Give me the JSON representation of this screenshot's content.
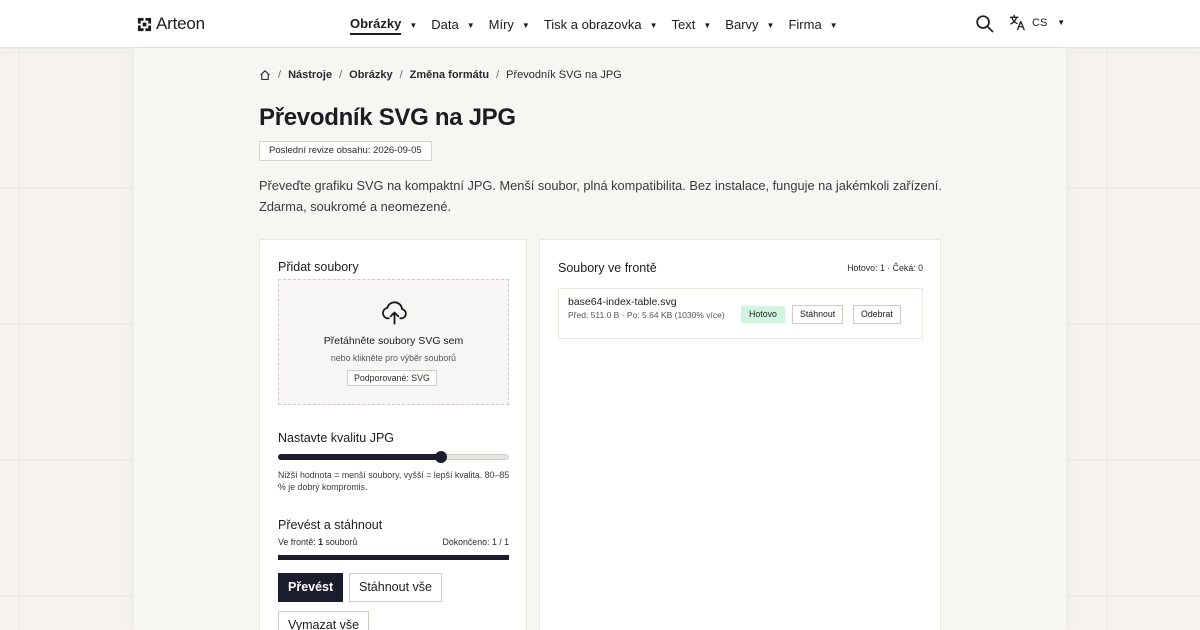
{
  "header": {
    "brand": "Arteon",
    "nav": [
      {
        "label": "Obrázky",
        "active": true
      },
      {
        "label": "Data"
      },
      {
        "label": "Míry"
      },
      {
        "label": "Tisk a obrazovka"
      },
      {
        "label": "Text"
      },
      {
        "label": "Barvy"
      },
      {
        "label": "Firma"
      }
    ],
    "language": "CS"
  },
  "breadcrumb": {
    "items": [
      "Nástroje",
      "Obrázky",
      "Změna formátu"
    ],
    "current": "Převodník SVG na JPG"
  },
  "page": {
    "title": "Převodník SVG na JPG",
    "revision": "Poslední revize obsahu: 2026-09-05",
    "intro": "Převeďte grafiku SVG na kompaktní JPG. Menší soubor, plná kompatibilita. Bez instalace, funguje na jakémkoli zařízení. Zdarma, soukromé a neomezené."
  },
  "upload": {
    "title": "Přidat soubory",
    "drop_text": "Přetáhněte soubory SVG sem",
    "drop_sub": "nebo klikněte pro výběr souborů",
    "supported": "Podporované: SVG"
  },
  "quality": {
    "title": "Nastavte kvalitu JPG",
    "value_fraction": 0.705,
    "hint": "Nižší hodnota = menší soubory, vyšší = lepší kvalita. 80–85 % je dobrý kompromis."
  },
  "convert": {
    "title": "Převést a stáhnout",
    "queue_prefix": "Ve frontě: ",
    "queue_count": "1",
    "queue_suffix": " souborů",
    "done": "Dokončeno: 1 / 1",
    "progress_fraction": 1.0,
    "convert_label": "Převést",
    "download_all_label": "Stáhnout vše",
    "clear_label": "Vymazat vše"
  },
  "queue": {
    "title": "Soubory ve frontě",
    "counts": "Hotovo: 1 · Čeká: 0",
    "files": [
      {
        "name": "base64-index-table.svg",
        "meta": "Před: 511.0 B · Po: 5.64 KB (1030% více)",
        "status": "Hotovo",
        "download_label": "Stáhnout",
        "remove_label": "Odebrat"
      }
    ]
  },
  "colors": {
    "accent": "#1b1d2e",
    "status_done_bg": "#d1f4e0",
    "page_bg": "#f6f3ef"
  }
}
